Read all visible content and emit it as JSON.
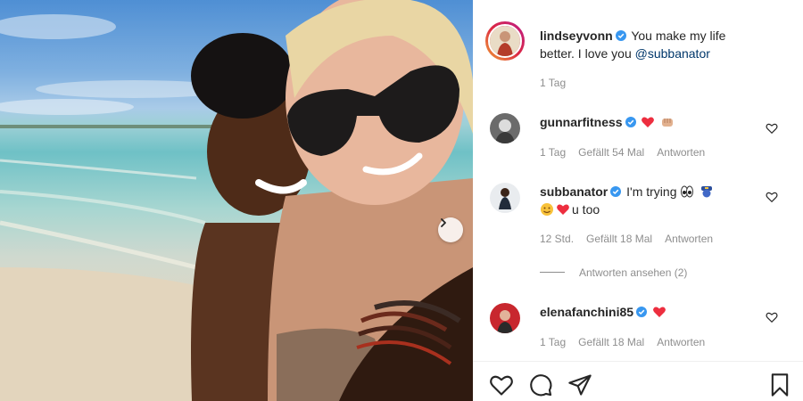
{
  "post": {
    "next_button": "next-photo",
    "caption": {
      "username": "lindseyvonn",
      "text_line1": "You make my life",
      "text_line2": "better. I love you",
      "mention": "@subbanator",
      "time": "1 Tag"
    }
  },
  "comments": [
    {
      "username": "gunnarfitness",
      "emojis": [
        "red-heart",
        "fist-bump"
      ],
      "time": "1 Tag",
      "likes": "Gefällt 54 Mal",
      "reply": "Antworten"
    },
    {
      "username": "subbanator",
      "text": "I'm trying",
      "emojis_line1": [
        "eyes",
        "police-officer"
      ],
      "emojis_line2": [
        "smiling-face-with-hearts",
        "red-heart"
      ],
      "text_line2": "u too",
      "time": "12 Std.",
      "likes": "Gefällt 18 Mal",
      "reply": "Antworten",
      "view_replies": "Antworten ansehen (2)"
    },
    {
      "username": "elenafanchini85",
      "emojis": [
        "red-heart"
      ],
      "time": "1 Tag",
      "likes": "Gefällt 18 Mal",
      "reply": "Antworten"
    }
  ],
  "colors": {
    "verified": "#3897f0",
    "mention": "#00376b",
    "meta": "#8e8e8e",
    "heart": "#ed4956"
  },
  "icons": {
    "action_bar": [
      "like-icon",
      "comment-icon",
      "share-icon",
      "save-icon"
    ]
  }
}
